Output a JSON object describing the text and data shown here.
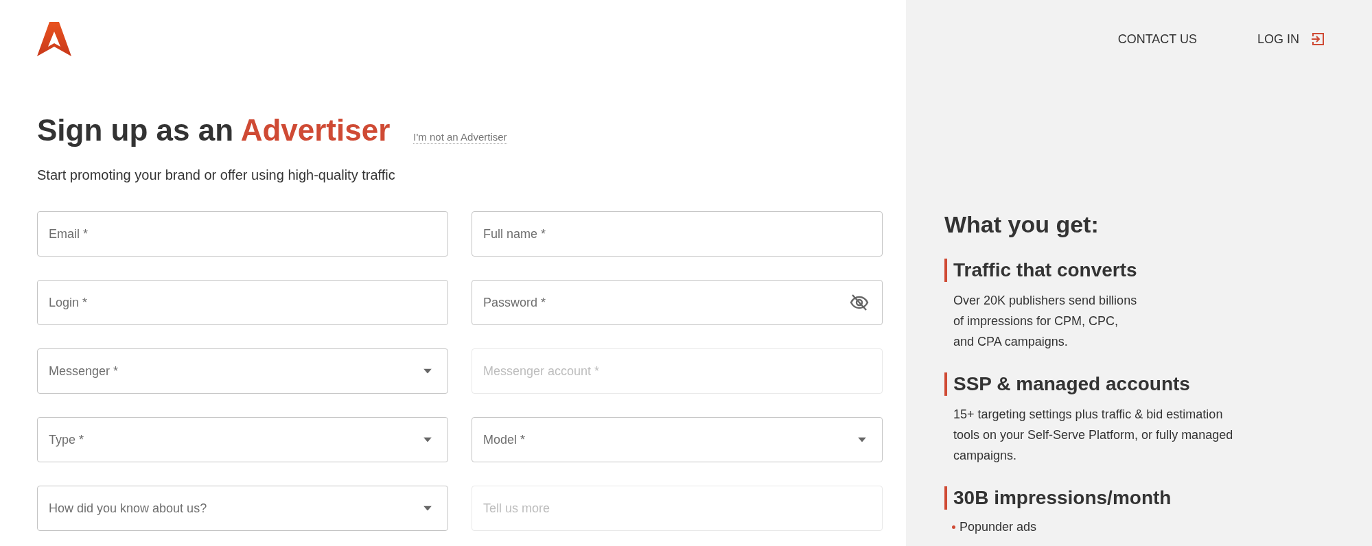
{
  "header": {
    "nav": [
      {
        "label": "CONTACT US",
        "kind": "link"
      },
      {
        "label": "LOG IN",
        "kind": "login"
      }
    ]
  },
  "signup": {
    "title_prefix": "Sign up as an",
    "title_highlight": "Advertiser",
    "switch_link": "I'm not an Advertiser",
    "subtitle": "Start promoting your brand or offer using high-quality traffic",
    "fields": [
      {
        "placeholder": "Email *",
        "kind": "text",
        "disabled": false
      },
      {
        "placeholder": "Full name *",
        "kind": "text",
        "disabled": false
      },
      {
        "placeholder": "Login *",
        "kind": "text",
        "disabled": false
      },
      {
        "placeholder": "Password *",
        "kind": "password",
        "disabled": false
      },
      {
        "placeholder": "Messenger *",
        "kind": "select",
        "disabled": false
      },
      {
        "placeholder": "Messenger account *",
        "kind": "text",
        "disabled": true
      },
      {
        "placeholder": "Type *",
        "kind": "select",
        "disabled": false
      },
      {
        "placeholder": "Model *",
        "kind": "select",
        "disabled": false
      },
      {
        "placeholder": "How did you know about us?",
        "kind": "select",
        "disabled": false
      },
      {
        "placeholder": "Tell us more",
        "kind": "text",
        "disabled": true
      }
    ]
  },
  "benefits": {
    "title": "What you get:",
    "sections": [
      {
        "heading": "Traffic that converts",
        "lines": [
          "Over 20K publishers send billions",
          "of impressions for CPM, CPC,",
          "and CPA campaigns."
        ]
      },
      {
        "heading": "SSP & managed accounts",
        "lines": [
          "15+ targeting settings plus traffic & bid estimation",
          "tools on your Self-Serve Platform, or fully managed",
          "campaigns."
        ]
      },
      {
        "heading": "30B impressions/month",
        "bullets": [
          "Popunder ads"
        ]
      }
    ]
  }
}
